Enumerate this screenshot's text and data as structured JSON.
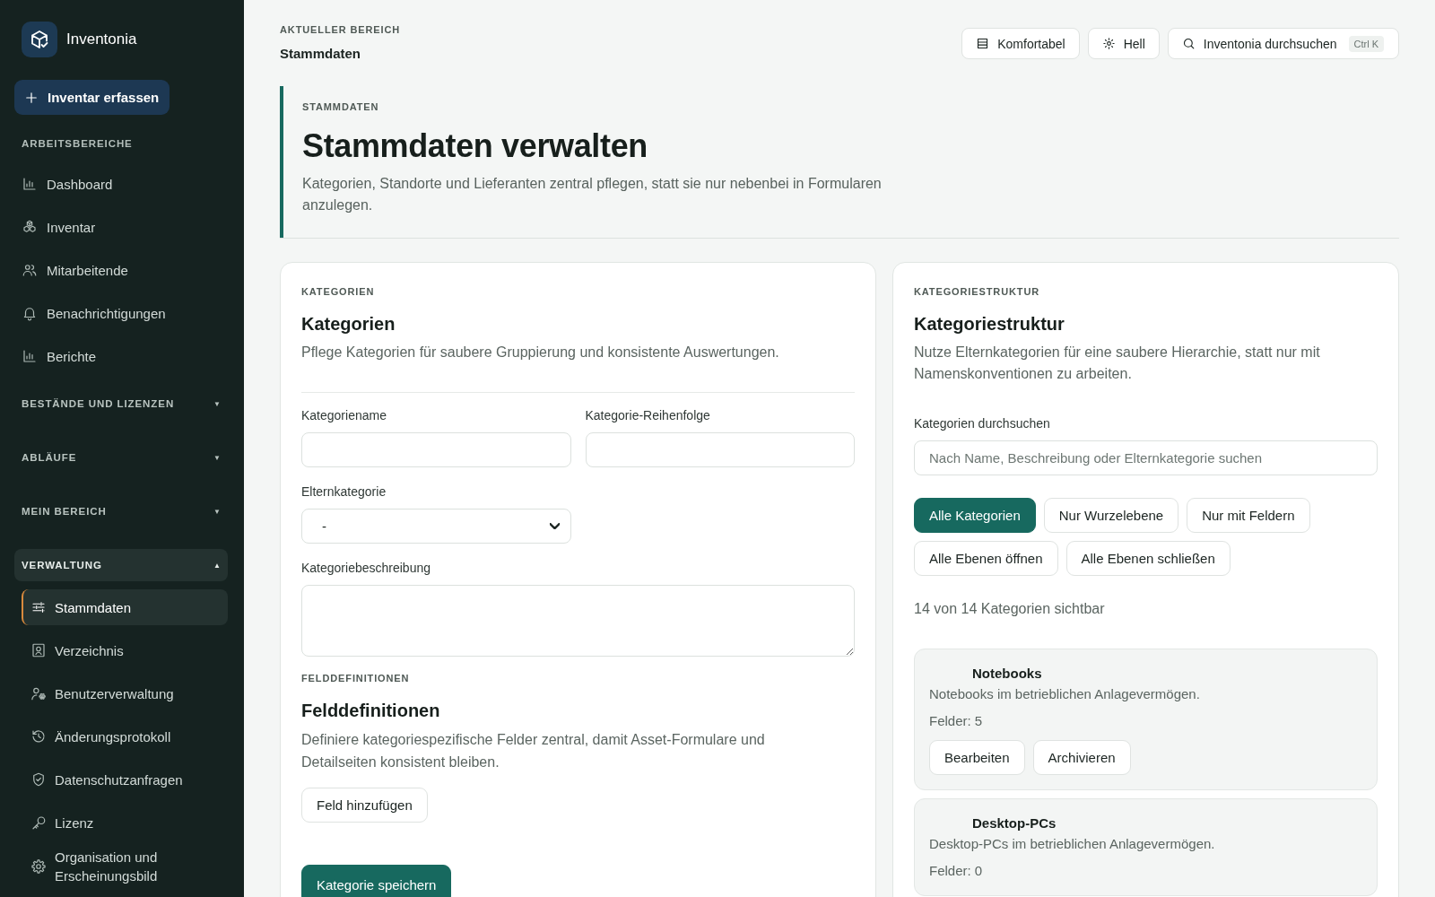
{
  "sidebar": {
    "brand": "Inventonia",
    "create_button": "Inventar erfassen",
    "sections": [
      {
        "title": "ARBEITSBEREICHE",
        "items": [
          {
            "label": "Dashboard",
            "selected": false
          },
          {
            "label": "Inventar",
            "selected": false
          },
          {
            "label": "Mitarbeitende",
            "selected": false
          },
          {
            "label": "Benachrichtigungen",
            "selected": false
          },
          {
            "label": "Berichte",
            "selected": false
          }
        ]
      }
    ],
    "groups": [
      {
        "title": "BESTÄNDE UND LIZENZEN",
        "caret": "▼",
        "expanded": false
      },
      {
        "title": "ABLÄUFE",
        "caret": "▼",
        "expanded": false
      },
      {
        "title": "MEIN BEREICH",
        "caret": "▼",
        "expanded": false
      },
      {
        "title": "VERWALTUNG",
        "caret": "▲",
        "expanded": true,
        "items": [
          {
            "label": "Stammdaten",
            "selected": true
          },
          {
            "label": "Verzeichnis",
            "selected": false
          },
          {
            "label": "Benutzerverwaltung",
            "selected": false
          },
          {
            "label": "Änderungsprotokoll",
            "selected": false
          },
          {
            "label": "Datenschutzanfragen",
            "selected": false
          },
          {
            "label": "Lizenz",
            "selected": false
          },
          {
            "label": "Organisation und Erscheinungsbild",
            "selected": false
          }
        ]
      }
    ]
  },
  "header": {
    "eyebrow": "AKTUELLER BEREICH",
    "current": "Stammdaten",
    "toolbar": [
      {
        "label": "Komfortabel"
      },
      {
        "label": "Hell"
      }
    ],
    "search": {
      "label": "Inventonia durchsuchen",
      "shortcut": "Ctrl K"
    }
  },
  "hero": {
    "eyebrow": "STAMMDATEN",
    "title": "Stammdaten verwalten",
    "description": "Kategorien, Standorte und Lieferanten zentral pflegen, statt sie nur nebenbei in Formularen anzulegen."
  },
  "category_form": {
    "eyebrow": "KATEGORIEN",
    "title": "Kategorien",
    "description": "Pflege Kategorien für saubere Gruppierung und konsistente Auswertungen.",
    "fields": [
      {
        "kind": "text",
        "label": "Kategoriename"
      },
      {
        "kind": "text",
        "label": "Kategorie-Reihenfolge"
      },
      {
        "kind": "select",
        "label": "Elternkategorie",
        "value": "-"
      },
      {
        "kind": "textarea",
        "label": "Kategoriebeschreibung"
      }
    ],
    "field_definitions": {
      "eyebrow": "FELDDEFINITIONEN",
      "title": "Felddefinitionen",
      "description": "Definiere kategoriespezifische Felder zentral, damit Asset-Formulare und Detailseiten konsistent bleiben.",
      "button": "Feld hinzufügen"
    },
    "submit": "Kategorie speichern"
  },
  "category_structure": {
    "eyebrow": "KATEGORIESTRUKTUR",
    "title": "Kategoriestruktur",
    "description": "Nutze Elternkategorien für eine saubere Hierarchie, statt nur mit Namenskonventionen zu arbeiten.",
    "search": {
      "label": "Kategorien durchsuchen",
      "placeholder": "Nach Name, Beschreibung oder Elternkategorie suchen"
    },
    "filters": [
      {
        "label": "Alle Kategorien",
        "selected": true
      },
      {
        "label": "Nur Wurzelebene",
        "selected": false
      },
      {
        "label": "Nur mit Feldern",
        "selected": false
      }
    ],
    "level_actions": [
      "Alle Ebenen öffnen",
      "Alle Ebenen schließen"
    ],
    "count": "14 von 14 Kategorien sichtbar",
    "categories": [
      {
        "name": "Notebooks",
        "description": "Notebooks im betrieblichen Anlagevermögen.",
        "fields": "Felder: 5",
        "actions": [
          "Bearbeiten",
          "Archivieren"
        ]
      },
      {
        "name": "Desktop-PCs",
        "description": "Desktop-PCs im betrieblichen Anlagevermögen.",
        "fields": "Felder: 0"
      }
    ]
  }
}
